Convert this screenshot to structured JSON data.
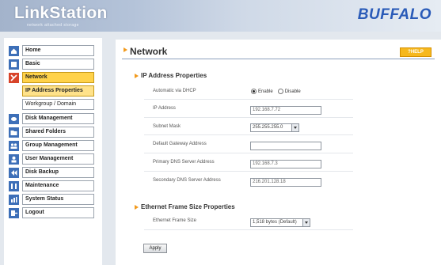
{
  "header": {
    "logo_text": "LinkStation",
    "logo_subtitle": "network attached storage",
    "brand": "BUFFALO"
  },
  "sidebar": {
    "items": [
      {
        "label": "Home",
        "icon": "home-icon",
        "color": "#3d6fb8"
      },
      {
        "label": "Basic",
        "icon": "basic-settings-icon",
        "color": "#3d6fb8"
      },
      {
        "label": "Network",
        "icon": "network-icon",
        "color": "#d8442a",
        "active": true
      },
      {
        "label": "IP Address Properties",
        "sub": true,
        "selected": true
      },
      {
        "label": "Workgroup / Domain",
        "sub": true
      },
      {
        "label": "Disk Management",
        "icon": "disk-management-icon",
        "color": "#3d6fb8"
      },
      {
        "label": "Shared Folders",
        "icon": "shared-folders-icon",
        "color": "#3d6fb8"
      },
      {
        "label": "Group Management",
        "icon": "group-management-icon",
        "color": "#3d6fb8"
      },
      {
        "label": "User Management",
        "icon": "user-management-icon",
        "color": "#3d6fb8"
      },
      {
        "label": "Disk Backup",
        "icon": "disk-backup-icon",
        "color": "#3d6fb8"
      },
      {
        "label": "Maintenance",
        "icon": "maintenance-icon",
        "color": "#3d6fb8"
      },
      {
        "label": "System Status",
        "icon": "system-status-icon",
        "color": "#3d6fb8"
      },
      {
        "label": "Logout",
        "icon": "logout-icon",
        "color": "#3d6fb8"
      }
    ]
  },
  "main": {
    "title": "Network",
    "help_label": "?HELP",
    "ip_section": {
      "title": "IP Address Properties",
      "dhcp_label": "Automatic via DHCP",
      "dhcp_enable": "Enable",
      "dhcp_disable": "Disable",
      "ip_label": "IP Address",
      "ip_value": "192.168.7.72",
      "subnet_label": "Subnet Mask",
      "subnet_value": "255.255.255.0",
      "gateway_label": "Default Gateway Address",
      "gateway_value": "",
      "dns1_label": "Primary DNS Server Address",
      "dns1_value": "192.168.7.3",
      "dns2_label": "Secondary DNS Server Address",
      "dns2_value": "216.201.128.18"
    },
    "frame_section": {
      "title": "Ethernet Frame Size Properties",
      "frame_label": "Ethernet Frame Size",
      "frame_value": "1,518 bytes (Default)"
    },
    "apply_label": "Apply"
  },
  "colors": {
    "accent": "#f29a1d",
    "active_nav": "#ffd24a",
    "brand": "#2a5bb8"
  }
}
